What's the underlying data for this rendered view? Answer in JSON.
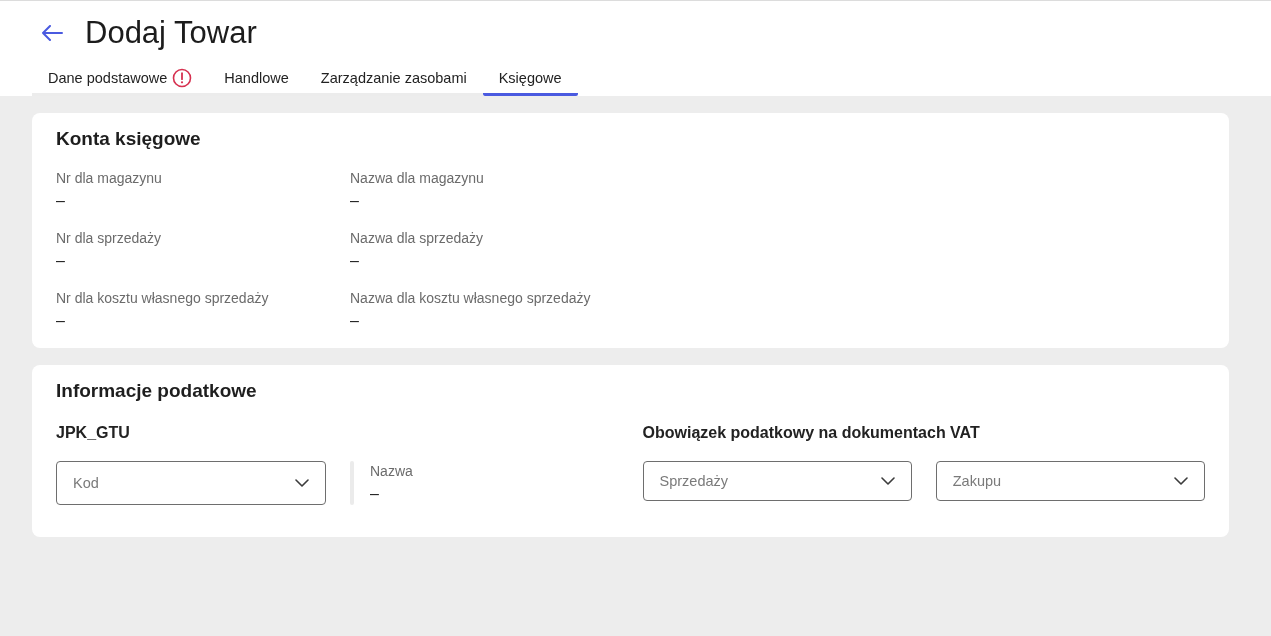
{
  "header": {
    "title": "Dodaj Towar"
  },
  "tabs": [
    {
      "label": "Dane podstawowe",
      "selected": false,
      "warning": true
    },
    {
      "label": "Handlowe",
      "selected": false,
      "warning": false
    },
    {
      "label": "Zarządzanie zasobami",
      "selected": false,
      "warning": false
    },
    {
      "label": "Księgowe",
      "selected": true,
      "warning": false
    }
  ],
  "accounts_card": {
    "title": "Konta księgowe",
    "fields": [
      {
        "label": "Nr dla magazynu",
        "value": "–"
      },
      {
        "label": "Nazwa dla magazynu",
        "value": "–"
      },
      {
        "label": "Nr dla sprzedaży",
        "value": "–"
      },
      {
        "label": "Nazwa dla sprzedaży",
        "value": "–"
      },
      {
        "label": "Nr dla kosztu własnego sprzedaży",
        "value": "–"
      },
      {
        "label": "Nazwa dla kosztu własnego sprzedaży",
        "value": "–"
      }
    ]
  },
  "tax_card": {
    "title": "Informacje podatkowe",
    "jpk_gtu": {
      "heading": "JPK_GTU",
      "code_select": {
        "placeholder": "Kod"
      },
      "name_field": {
        "label": "Nazwa",
        "value": "–"
      }
    },
    "vat_obligation": {
      "heading": "Obowiązek podatkowy na dokumentach VAT",
      "selects": [
        {
          "placeholder": "Sprzedaży"
        },
        {
          "placeholder": "Zakupu"
        }
      ]
    }
  }
}
